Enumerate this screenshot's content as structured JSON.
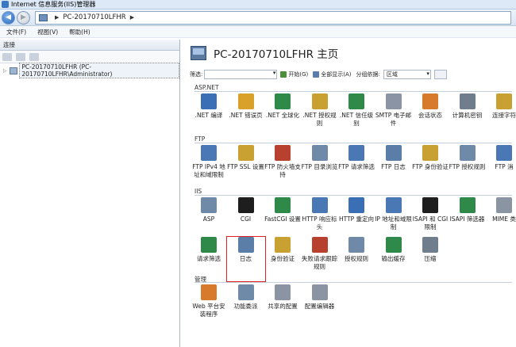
{
  "window": {
    "title": "Internet 信息服务(IIS)管理器"
  },
  "nav": {
    "address_text": "PC-20170710LFHR",
    "sep": "▶"
  },
  "menu": [
    "文件(F)",
    "视图(V)",
    "帮助(H)"
  ],
  "left": {
    "header": "连接",
    "tree_item": "PC-20170710LFHR (PC-20170710LFHR\\Administrator)"
  },
  "right": {
    "title": "PC-20170710LFHR 主页",
    "filter_label": "筛选:",
    "start_label": "开始(G)",
    "show_all_label": "全部显示(A)",
    "group_label": "分组依据:",
    "group_value": "区域",
    "sections": [
      {
        "name": "ASP.NET",
        "items": [
          {
            "label": ".NET 编译",
            "icon": "dotnet-compile-icon",
            "color": "#3a6fb6"
          },
          {
            "label": ".NET 错误页",
            "icon": "dotnet-error-page-icon",
            "color": "#d9a02a"
          },
          {
            "label": ".NET 全球化",
            "icon": "globe-icon",
            "color": "#2f8a4a"
          },
          {
            "label": ".NET 授权规则",
            "icon": "lock-icon",
            "color": "#c9a032"
          },
          {
            "label": ".NET 信任级别",
            "icon": "trust-shield-icon",
            "color": "#2f8a4a"
          },
          {
            "label": "SMTP 电子邮件",
            "icon": "mail-icon",
            "color": "#8a94a3"
          },
          {
            "label": "会话状态",
            "icon": "session-icon",
            "color": "#d77a2b"
          },
          {
            "label": "计算机密钥",
            "icon": "machine-key-icon",
            "color": "#6f7d8c"
          },
          {
            "label": "连接字符",
            "icon": "connection-string-icon",
            "color": "#c9a032"
          }
        ]
      },
      {
        "name": "FTP",
        "items": [
          {
            "label": "FTP IPv4 地址和域限制",
            "icon": "ftp-ip-icon",
            "color": "#4a78b5"
          },
          {
            "label": "FTP SSL 设置",
            "icon": "ftp-ssl-icon",
            "color": "#c9a032"
          },
          {
            "label": "FTP 防火墙支持",
            "icon": "ftp-firewall-icon",
            "color": "#b8402e"
          },
          {
            "label": "FTP 目录浏览",
            "icon": "ftp-dir-icon",
            "color": "#6f8aa8"
          },
          {
            "label": "FTP 请求筛选",
            "icon": "ftp-filter-icon",
            "color": "#4a78b5"
          },
          {
            "label": "FTP 日志",
            "icon": "ftp-log-icon",
            "color": "#5a7ea8"
          },
          {
            "label": "FTP 身份验证",
            "icon": "ftp-auth-icon",
            "color": "#c9a032"
          },
          {
            "label": "FTP 授权规则",
            "icon": "ftp-authz-icon",
            "color": "#6f8aa8"
          },
          {
            "label": "FTP 消",
            "icon": "ftp-message-icon",
            "color": "#4a78b5"
          }
        ]
      },
      {
        "name": "IIS",
        "items": [
          {
            "label": "ASP",
            "icon": "asp-icon",
            "color": "#6f8aa8"
          },
          {
            "label": "CGI",
            "icon": "cgi-icon",
            "color": "#1e1e1e"
          },
          {
            "label": "FastCGI 设置",
            "icon": "fastcgi-icon",
            "color": "#2f8a4a"
          },
          {
            "label": "HTTP 响应标头",
            "icon": "http-headers-icon",
            "color": "#4a78b5"
          },
          {
            "label": "HTTP 重定向",
            "icon": "http-redirect-icon",
            "color": "#3a6fb6"
          },
          {
            "label": "IP 地址和域限制",
            "icon": "ip-restrict-icon",
            "color": "#4a78b5"
          },
          {
            "label": "ISAPI 和 CGI 限制",
            "icon": "isapi-cgi-icon",
            "color": "#1e1e1e"
          },
          {
            "label": "ISAPI 筛选器",
            "icon": "isapi-filter-icon",
            "color": "#2f8a4a"
          },
          {
            "label": "MIME 类",
            "icon": "mime-icon",
            "color": "#8a94a3"
          },
          {
            "label": "请求筛选",
            "icon": "request-filter-icon",
            "color": "#2f8a4a"
          },
          {
            "label": "日志",
            "icon": "log-icon",
            "color": "#5a7ea8",
            "highlighted": true
          },
          {
            "label": "身份验证",
            "icon": "auth-icon",
            "color": "#c9a032"
          },
          {
            "label": "失败请求跟踪规则",
            "icon": "failed-request-icon",
            "color": "#b8402e"
          },
          {
            "label": "授权规则",
            "icon": "authz-icon",
            "color": "#6f8aa8"
          },
          {
            "label": "输出缓存",
            "icon": "output-cache-icon",
            "color": "#2f8a4a"
          },
          {
            "label": "压缩",
            "icon": "compress-icon",
            "color": "#6f7d8c"
          }
        ]
      },
      {
        "name": "管理",
        "items": [
          {
            "label": "Web 平台安装程序",
            "icon": "web-platform-icon",
            "color": "#d77a2b"
          },
          {
            "label": "功能委派",
            "icon": "delegation-icon",
            "color": "#6f8aa8"
          },
          {
            "label": "共享的配置",
            "icon": "shared-config-icon",
            "color": "#8a94a3"
          },
          {
            "label": "配置编辑器",
            "icon": "config-editor-icon",
            "color": "#8a94a3"
          }
        ]
      }
    ]
  }
}
